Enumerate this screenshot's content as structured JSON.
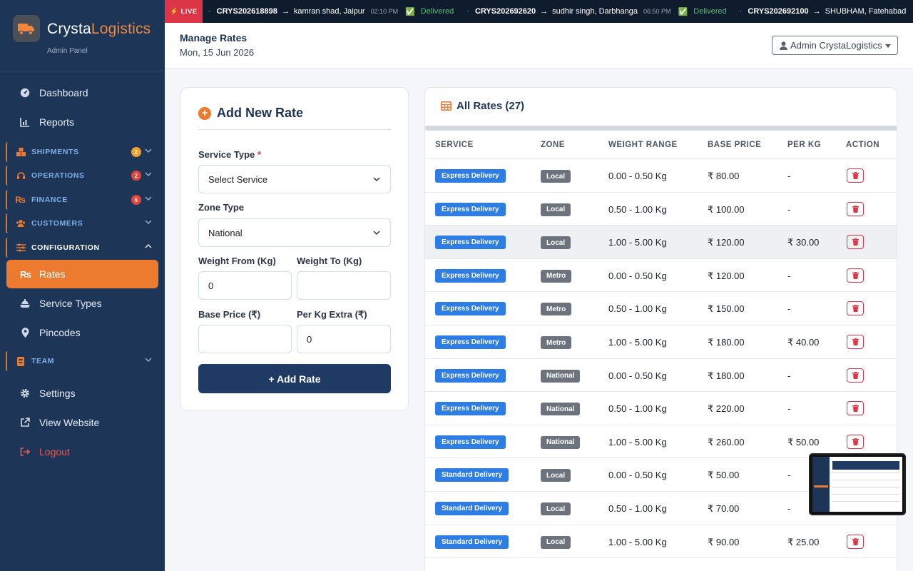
{
  "brand": {
    "name_a": "Crysta",
    "name_b": "Logistics",
    "sub": "Admin Panel"
  },
  "sidebar": {
    "top": [
      {
        "label": "Dashboard"
      },
      {
        "label": "Reports"
      }
    ],
    "sections": [
      {
        "label": "SHIPMENTS",
        "badge": "2",
        "badge_color": "#f0a030"
      },
      {
        "label": "OPERATIONS",
        "badge": "2",
        "badge_color": "#e0463e"
      },
      {
        "label": "FINANCE",
        "badge": "6",
        "badge_color": "#e0463e"
      },
      {
        "label": "CUSTOMERS",
        "badge": ""
      },
      {
        "label": "CONFIGURATION",
        "badge": ""
      },
      {
        "label": "TEAM",
        "badge": ""
      }
    ],
    "config_items": [
      {
        "label": "Rates"
      },
      {
        "label": "Service Types"
      },
      {
        "label": "Pincodes"
      }
    ],
    "bottom": [
      {
        "label": "Settings"
      },
      {
        "label": "View Website"
      },
      {
        "label": "Logout"
      }
    ]
  },
  "ticker": {
    "live": "LIVE",
    "items": [
      {
        "id": "CRYS202618898",
        "route": "kamran shad, Jaipur",
        "time": "02:10 PM",
        "status": "Delivered"
      },
      {
        "id": "CRYS202692620",
        "route": "sudhir singh, Darbhanga",
        "time": "06:50 PM",
        "status": "Delivered"
      },
      {
        "id": "CRYS202692100",
        "route": "SHUBHAM, Fatehabad",
        "time": "",
        "status": ""
      }
    ]
  },
  "header": {
    "title": "Manage Rates",
    "date": "Mon, 15 Jun 2026",
    "user": "Admin CrystaLogistics"
  },
  "form": {
    "title": "Add New Rate",
    "service_label": "Service Type",
    "service_required": "*",
    "service_value": "Select Service",
    "zone_label": "Zone Type",
    "zone_value": "National",
    "wfrom_label": "Weight From (Kg)",
    "wfrom_value": "0",
    "wto_label": "Weight To (Kg)",
    "wto_value": "",
    "base_label": "Base Price (₹)",
    "base_value": "",
    "perkg_label": "Per Kg Extra (₹)",
    "perkg_value": "0",
    "submit": "+ Add Rate"
  },
  "rates": {
    "title": "All Rates (27)",
    "columns": [
      "SERVICE",
      "ZONE",
      "WEIGHT RANGE",
      "BASE PRICE",
      "PER KG",
      "ACTION"
    ],
    "rows": [
      {
        "service": "Express Delivery",
        "zone": "Local",
        "weight": "0.00 - 0.50 Kg",
        "base": "₹ 80.00",
        "perkg": "-"
      },
      {
        "service": "Express Delivery",
        "zone": "Local",
        "weight": "0.50 - 1.00 Kg",
        "base": "₹ 100.00",
        "perkg": "-"
      },
      {
        "service": "Express Delivery",
        "zone": "Local",
        "weight": "1.00 - 5.00 Kg",
        "base": "₹ 120.00",
        "perkg": "₹ 30.00"
      },
      {
        "service": "Express Delivery",
        "zone": "Metro",
        "weight": "0.00 - 0.50 Kg",
        "base": "₹ 120.00",
        "perkg": "-"
      },
      {
        "service": "Express Delivery",
        "zone": "Metro",
        "weight": "0.50 - 1.00 Kg",
        "base": "₹ 150.00",
        "perkg": "-"
      },
      {
        "service": "Express Delivery",
        "zone": "Metro",
        "weight": "1.00 - 5.00 Kg",
        "base": "₹ 180.00",
        "perkg": "₹ 40.00"
      },
      {
        "service": "Express Delivery",
        "zone": "National",
        "weight": "0.00 - 0.50 Kg",
        "base": "₹ 180.00",
        "perkg": "-"
      },
      {
        "service": "Express Delivery",
        "zone": "National",
        "weight": "0.50 - 1.00 Kg",
        "base": "₹ 220.00",
        "perkg": "-"
      },
      {
        "service": "Express Delivery",
        "zone": "National",
        "weight": "1.00 - 5.00 Kg",
        "base": "₹ 260.00",
        "perkg": "₹ 50.00"
      },
      {
        "service": "Standard Delivery",
        "zone": "Local",
        "weight": "0.00 - 0.50 Kg",
        "base": "₹ 50.00",
        "perkg": "-"
      },
      {
        "service": "Standard Delivery",
        "zone": "Local",
        "weight": "0.50 - 1.00 Kg",
        "base": "₹ 70.00",
        "perkg": "-"
      },
      {
        "service": "Standard Delivery",
        "zone": "Local",
        "weight": "1.00 - 5.00 Kg",
        "base": "₹ 90.00",
        "perkg": "₹ 25.00"
      }
    ]
  },
  "colors": {
    "accent": "#ec7a2f",
    "sidebar": "#1d3557",
    "primary_button": "#1f3a63",
    "service_badge": "#2d7de4",
    "zone_badge": "#6c737c",
    "danger": "#dc3545"
  }
}
